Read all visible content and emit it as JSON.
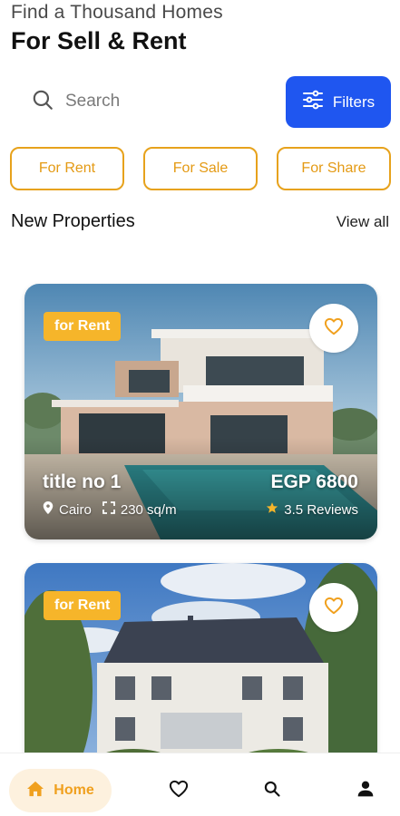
{
  "header": {
    "subtitle": "Find a Thousand Homes",
    "title": "For Sell & Rent"
  },
  "search": {
    "placeholder": "Search",
    "icon": "search-icon"
  },
  "filters": {
    "label": "Filters",
    "icon": "sliders-icon",
    "color": "#1f56f0"
  },
  "chips": [
    {
      "label": "For Rent"
    },
    {
      "label": "For Sale"
    },
    {
      "label": "For Share"
    }
  ],
  "section": {
    "title": "New Properties",
    "view_all": "View all"
  },
  "accent_color": "#f6b52a",
  "properties": [
    {
      "badge": "for Rent",
      "title": "title no 1",
      "price": "EGP 6800",
      "location": "Cairo",
      "area": "230 sq/m",
      "rating": "3.5 Reviews"
    },
    {
      "badge": "for Rent"
    }
  ],
  "bottom_nav": {
    "home_label": "Home",
    "items": [
      "home-icon",
      "heart-icon",
      "search-icon",
      "user-icon"
    ]
  }
}
